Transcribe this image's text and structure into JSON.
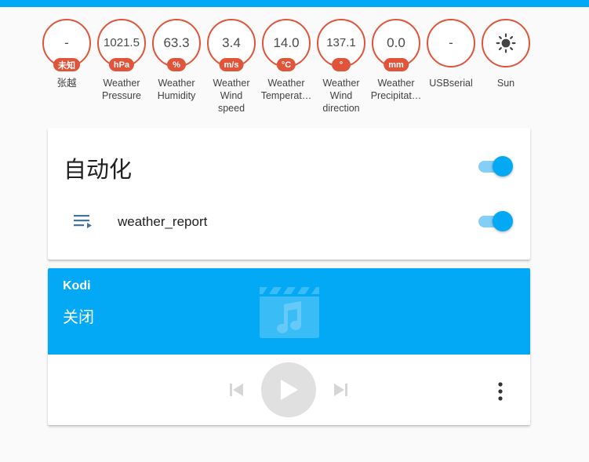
{
  "colors": {
    "accent": "#03a9f4",
    "badge_ring": "#e0543a",
    "toggle_track": "#84cff7",
    "controls_disabled": "#e0e0e0"
  },
  "badges": [
    {
      "value": "-",
      "unit": "未知",
      "label": [
        "张越"
      ]
    },
    {
      "value": "1021.5",
      "unit": "hPa",
      "label": [
        "Weather",
        "Pressure"
      ]
    },
    {
      "value": "63.3",
      "unit": "%",
      "label": [
        "Weather",
        "Humidity"
      ]
    },
    {
      "value": "3.4",
      "unit": "m/s",
      "label": [
        "Weather",
        "Wind",
        "speed"
      ]
    },
    {
      "value": "14.0",
      "unit": "°C",
      "label": [
        "Weather",
        "Temperat…"
      ]
    },
    {
      "value": "137.1",
      "unit": "°",
      "label": [
        "Weather",
        "Wind",
        "direction"
      ]
    },
    {
      "value": "0.0",
      "unit": "mm",
      "label": [
        "Weather",
        "Precipitat…"
      ]
    },
    {
      "value": "-",
      "unit": "",
      "label": [
        "USBserial"
      ]
    },
    {
      "value": "",
      "unit": "",
      "icon": "sun-icon",
      "label": [
        "Sun"
      ]
    }
  ],
  "automation_card": {
    "title": "自动化",
    "master_toggle_on": true,
    "entities": [
      {
        "icon": "script-icon",
        "name": "weather_report",
        "on": true
      }
    ]
  },
  "media_player": {
    "name": "Kodi",
    "state": "关闭",
    "art_icon": "movie-music-icon",
    "controls": [
      "previous-icon",
      "play-icon",
      "next-icon",
      "more-vertical-icon"
    ]
  }
}
